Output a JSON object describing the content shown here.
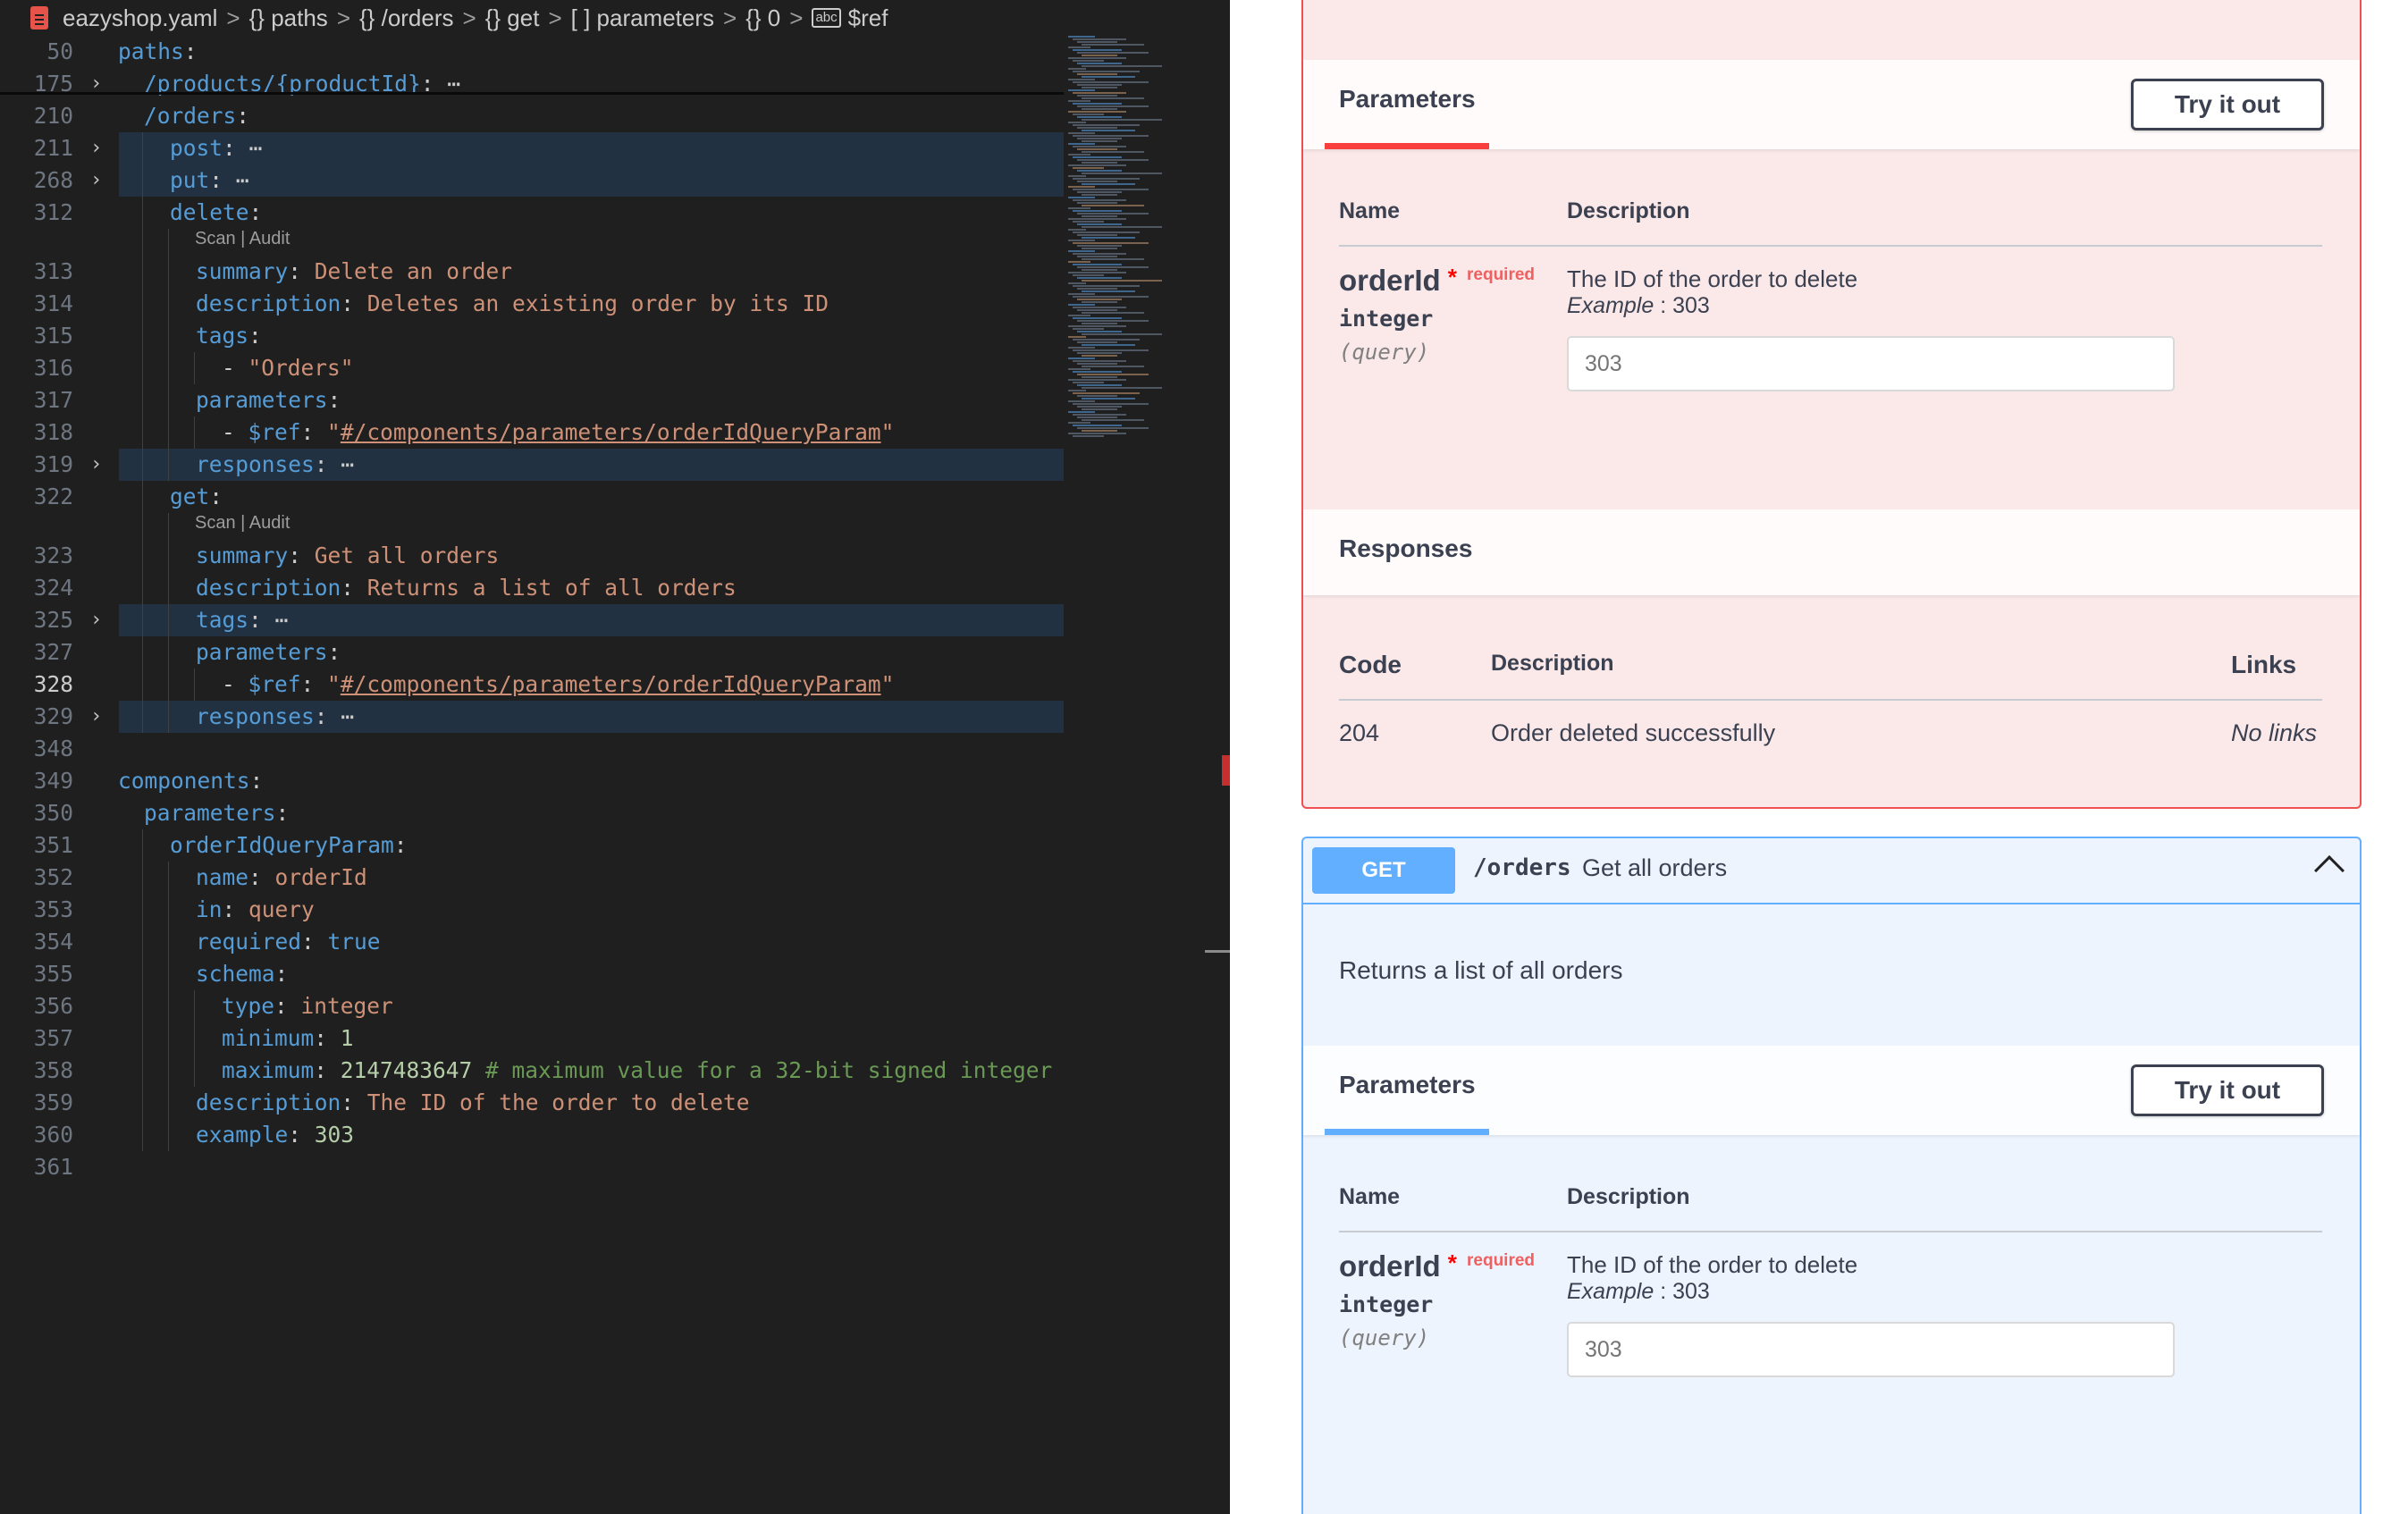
{
  "breadcrumb": {
    "file": "eazyshop.yaml",
    "path": [
      "{} paths",
      "{} /orders",
      "{} get",
      "[ ] parameters",
      "{} 0",
      "$ref"
    ]
  },
  "code_lines": [
    {
      "ln": "50",
      "parts": [
        [
          "k",
          "paths"
        ],
        [
          "p",
          ":"
        ]
      ],
      "indent": 0
    },
    {
      "ln": "175",
      "fold": true,
      "parts": [
        [
          "k",
          "/products/{productId}"
        ],
        [
          "p",
          ":"
        ],
        [
          "p",
          " ⋯"
        ]
      ],
      "indent": 1
    },
    {
      "ln": "210",
      "parts": [
        [
          "k",
          "/orders"
        ],
        [
          "p",
          ":"
        ]
      ],
      "indent": 1
    },
    {
      "ln": "211",
      "fold": true,
      "hl": true,
      "parts": [
        [
          "k",
          "post"
        ],
        [
          "p",
          ":"
        ],
        [
          "p",
          " ⋯"
        ]
      ],
      "indent": 2
    },
    {
      "ln": "268",
      "fold": true,
      "hl": true,
      "parts": [
        [
          "k",
          "put"
        ],
        [
          "p",
          ":"
        ],
        [
          "p",
          " ⋯"
        ]
      ],
      "indent": 2
    },
    {
      "ln": "312",
      "parts": [
        [
          "k",
          "delete"
        ],
        [
          "p",
          ":"
        ]
      ],
      "indent": 2,
      "lens": "Scan | Audit"
    },
    {
      "ln": "313",
      "parts": [
        [
          "k",
          "summary"
        ],
        [
          "p",
          ": "
        ],
        [
          "s",
          "Delete an order"
        ]
      ],
      "indent": 3
    },
    {
      "ln": "314",
      "parts": [
        [
          "k",
          "description"
        ],
        [
          "p",
          ": "
        ],
        [
          "s",
          "Deletes an existing order by its ID"
        ]
      ],
      "indent": 3
    },
    {
      "ln": "315",
      "parts": [
        [
          "k",
          "tags"
        ],
        [
          "p",
          ":"
        ]
      ],
      "indent": 3
    },
    {
      "ln": "316",
      "parts": [
        [
          "p",
          "- "
        ],
        [
          "s",
          "\"Orders\""
        ]
      ],
      "indent": 4
    },
    {
      "ln": "317",
      "parts": [
        [
          "k",
          "parameters"
        ],
        [
          "p",
          ":"
        ]
      ],
      "indent": 3
    },
    {
      "ln": "318",
      "parts": [
        [
          "p",
          "- "
        ],
        [
          "k",
          "$ref"
        ],
        [
          "p",
          ": "
        ],
        [
          "s",
          "\""
        ],
        [
          "su",
          "#/components/parameters/orderIdQueryParam"
        ],
        [
          "s",
          "\""
        ]
      ],
      "indent": 4
    },
    {
      "ln": "319",
      "fold": true,
      "hl": true,
      "parts": [
        [
          "k",
          "responses"
        ],
        [
          "p",
          ":"
        ],
        [
          "p",
          " ⋯"
        ]
      ],
      "indent": 3
    },
    {
      "ln": "322",
      "parts": [
        [
          "k",
          "get"
        ],
        [
          "p",
          ":"
        ]
      ],
      "indent": 2,
      "lens": "Scan | Audit"
    },
    {
      "ln": "323",
      "parts": [
        [
          "k",
          "summary"
        ],
        [
          "p",
          ": "
        ],
        [
          "s",
          "Get all orders"
        ]
      ],
      "indent": 3
    },
    {
      "ln": "324",
      "parts": [
        [
          "k",
          "description"
        ],
        [
          "p",
          ": "
        ],
        [
          "s",
          "Returns a list of all orders"
        ]
      ],
      "indent": 3
    },
    {
      "ln": "325",
      "fold": true,
      "hl": true,
      "parts": [
        [
          "k",
          "tags"
        ],
        [
          "p",
          ":"
        ],
        [
          "p",
          " ⋯"
        ]
      ],
      "indent": 3
    },
    {
      "ln": "327",
      "parts": [
        [
          "k",
          "parameters"
        ],
        [
          "p",
          ":"
        ]
      ],
      "indent": 3
    },
    {
      "ln": "328",
      "cur": true,
      "parts": [
        [
          "p",
          "- "
        ],
        [
          "k",
          "$ref"
        ],
        [
          "p",
          ": "
        ],
        [
          "s",
          "\""
        ],
        [
          "su",
          "#/components/parameters/orderIdQueryParam"
        ],
        [
          "s",
          "\""
        ]
      ],
      "indent": 4
    },
    {
      "ln": "329",
      "fold": true,
      "hl": true,
      "parts": [
        [
          "k",
          "responses"
        ],
        [
          "p",
          ":"
        ],
        [
          "p",
          " ⋯"
        ]
      ],
      "indent": 3
    },
    {
      "ln": "348",
      "parts": [],
      "indent": 0
    },
    {
      "ln": "349",
      "parts": [
        [
          "k",
          "components"
        ],
        [
          "p",
          ":"
        ]
      ],
      "indent": 0
    },
    {
      "ln": "350",
      "parts": [
        [
          "k",
          "parameters"
        ],
        [
          "p",
          ":"
        ]
      ],
      "indent": 1
    },
    {
      "ln": "351",
      "parts": [
        [
          "k",
          "orderIdQueryParam"
        ],
        [
          "p",
          ":"
        ]
      ],
      "indent": 2
    },
    {
      "ln": "352",
      "parts": [
        [
          "k",
          "name"
        ],
        [
          "p",
          ": "
        ],
        [
          "s",
          "orderId"
        ]
      ],
      "indent": 3
    },
    {
      "ln": "353",
      "parts": [
        [
          "k",
          "in"
        ],
        [
          "p",
          ": "
        ],
        [
          "s",
          "query"
        ]
      ],
      "indent": 3
    },
    {
      "ln": "354",
      "parts": [
        [
          "k",
          "required"
        ],
        [
          "p",
          ": "
        ],
        [
          "b",
          "true"
        ]
      ],
      "indent": 3
    },
    {
      "ln": "355",
      "parts": [
        [
          "k",
          "schema"
        ],
        [
          "p",
          ":"
        ]
      ],
      "indent": 3
    },
    {
      "ln": "356",
      "parts": [
        [
          "k",
          "type"
        ],
        [
          "p",
          ": "
        ],
        [
          "s",
          "integer"
        ]
      ],
      "indent": 4
    },
    {
      "ln": "357",
      "parts": [
        [
          "k",
          "minimum"
        ],
        [
          "p",
          ": "
        ],
        [
          "n",
          "1"
        ]
      ],
      "indent": 4
    },
    {
      "ln": "358",
      "parts": [
        [
          "k",
          "maximum"
        ],
        [
          "p",
          ": "
        ],
        [
          "n",
          "2147483647"
        ],
        [
          "c",
          " # maximum value for a 32-bit signed integer"
        ]
      ],
      "indent": 4
    },
    {
      "ln": "359",
      "parts": [
        [
          "k",
          "description"
        ],
        [
          "p",
          ": "
        ],
        [
          "s",
          "The ID of the order to delete"
        ]
      ],
      "indent": 3
    },
    {
      "ln": "360",
      "parts": [
        [
          "k",
          "example"
        ],
        [
          "p",
          ": "
        ],
        [
          "n",
          "303"
        ]
      ],
      "indent": 3
    },
    {
      "ln": "361",
      "parts": [],
      "indent": 0
    }
  ],
  "swagger": {
    "delete_op": {
      "parameters_title": "Parameters",
      "try_button": "Try it out",
      "col_name": "Name",
      "col_description": "Description",
      "param": {
        "name": "orderId",
        "star": "*",
        "required_label": "required",
        "type": "integer",
        "in": "(query)",
        "description": "The ID of the order to delete",
        "example_label": "Example",
        "example_value": ": 303",
        "input_placeholder": "303"
      },
      "responses_title": "Responses",
      "resp_col_code": "Code",
      "resp_col_description": "Description",
      "resp_col_links": "Links",
      "response": {
        "code": "204",
        "description": "Order deleted successfully",
        "links": "No links"
      }
    },
    "get_op": {
      "method": "GET",
      "path": "/orders",
      "summary": "Get all orders",
      "description": "Returns a list of all orders",
      "parameters_title": "Parameters",
      "try_button": "Try it out",
      "col_name": "Name",
      "col_description": "Description",
      "param": {
        "name": "orderId",
        "star": "*",
        "required_label": "required",
        "type": "integer",
        "in": "(query)",
        "description": "The ID of the order to delete",
        "example_label": "Example",
        "example_value": ": 303",
        "input_placeholder": "303"
      }
    }
  },
  "colors": {
    "delete_accent": "#f93e3e",
    "get_accent": "#61affe",
    "editor_bg": "#1f1f1f"
  }
}
